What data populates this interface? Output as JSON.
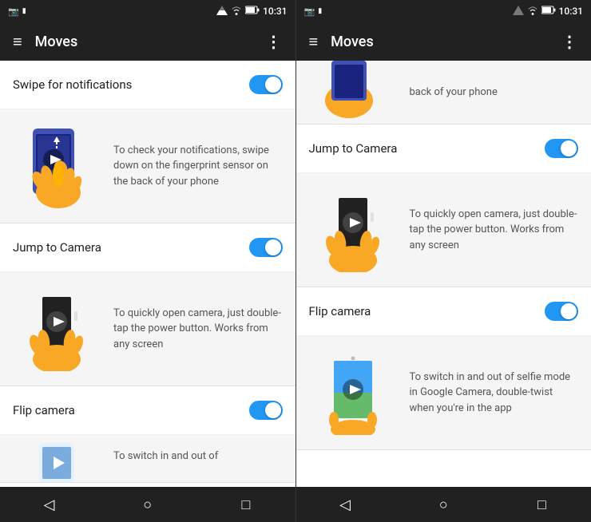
{
  "panel1": {
    "statusBar": {
      "leftIcon": "📷",
      "signal": "▲",
      "wifi": "▲",
      "battery": "▓",
      "time": "10:31"
    },
    "toolbar": {
      "menuIcon": "≡",
      "title": "Moves",
      "moreIcon": "⋮"
    },
    "settings": [
      {
        "label": "Swipe for notifications",
        "enabled": true,
        "demo": {
          "text": "To check your notifications, swipe down on the fingerprint sensor on the back of your phone",
          "imageType": "swipe"
        }
      },
      {
        "label": "Jump to Camera",
        "enabled": true,
        "demo": {
          "text": "To quickly open camera, just double-tap the power button. Works from any screen",
          "imageType": "camera"
        }
      },
      {
        "label": "Flip camera",
        "enabled": true,
        "demo": {
          "text": "To switch in and out of",
          "imageType": "flip"
        }
      }
    ],
    "navBar": {
      "back": "◁",
      "home": "○",
      "recent": "□"
    }
  },
  "panel2": {
    "statusBar": {
      "leftIcon": "📷",
      "signal": "▲",
      "wifi": "▲",
      "battery": "▓",
      "time": "10:31"
    },
    "toolbar": {
      "menuIcon": "≡",
      "title": "Moves",
      "moreIcon": "⋮"
    },
    "settings": [
      {
        "label": "Jump to Camera",
        "enabled": true,
        "demo": {
          "text": "To quickly open camera, just double-tap the power button. Works from any screen",
          "imageType": "camera"
        }
      },
      {
        "label": "Flip camera",
        "enabled": true,
        "demo": {
          "text": "To switch in and out of selfie mode in Google Camera, double-twist when you're in the app",
          "imageType": "flip"
        }
      }
    ],
    "navBar": {
      "back": "◁",
      "home": "○",
      "recent": "□"
    },
    "partialTop": {
      "text": "back of your phone",
      "imageType": "swipe-partial"
    }
  }
}
